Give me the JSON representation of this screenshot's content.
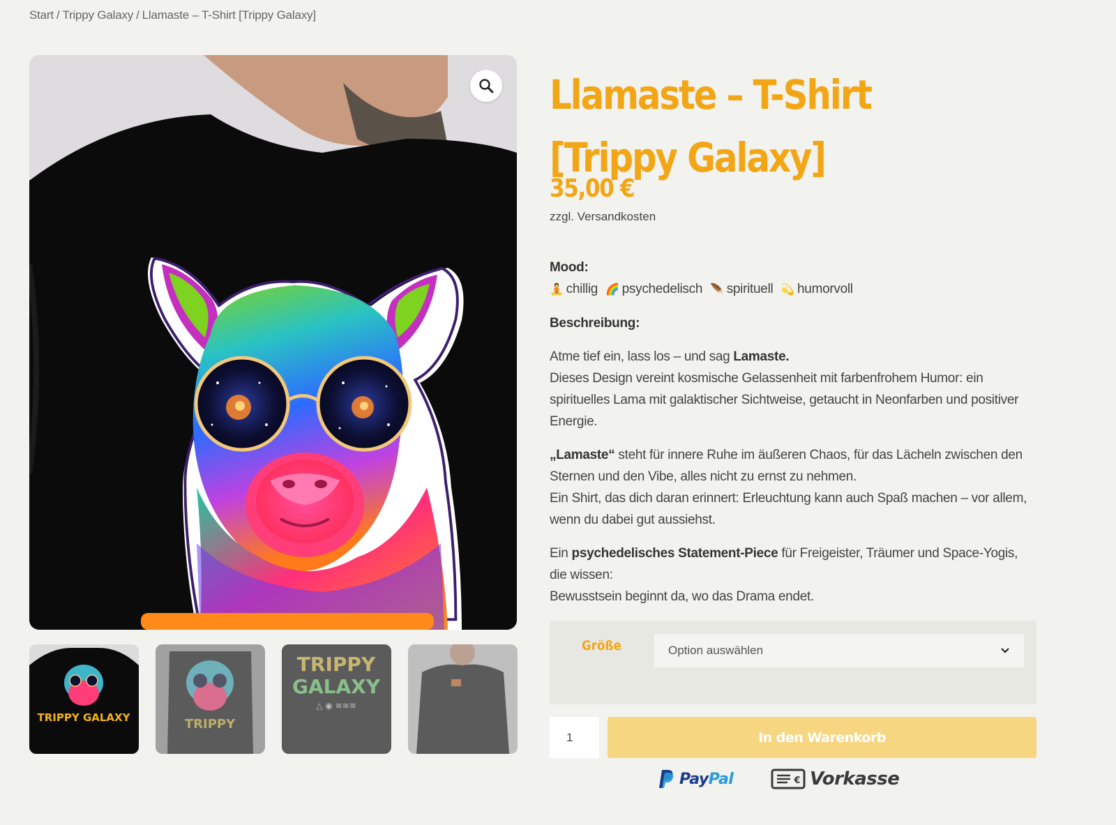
{
  "breadcrumb": {
    "home": "Start",
    "category": "Trippy Galaxy",
    "current": "Llamaste – T-Shirt [Trippy Galaxy]"
  },
  "product": {
    "title": "Llamaste – T-Shirt [Trippy Galaxy]",
    "price": "35,00 €",
    "shipping_note": "zzgl. Versandkosten",
    "image_alt": "Llama with galaxy sunglasses on black t-shirt",
    "badge_text": "TRIPPY GALAXY"
  },
  "description": {
    "mood_heading": "Mood:",
    "moods": [
      {
        "emoji": "🧘",
        "label": "chillig"
      },
      {
        "emoji": "🌈",
        "label": "psychedelisch"
      },
      {
        "emoji": "🪶",
        "label": "spirituell"
      },
      {
        "emoji": "💫",
        "label": "humorvoll"
      }
    ],
    "beschreibung_heading": "Beschreibung:",
    "p1_intro": "Atme tief ein, lass los – und sag ",
    "p1_bold": "Lamaste.",
    "p1_rest": "Dieses Design vereint kosmische Gelassenheit mit farbenfrohem Humor: ein spirituelles Lama mit galaktischer Sichtweise, getaucht in Neonfarben und positiver Energie.",
    "p2_bold": "„Lamaste“",
    "p2_rest": " steht für innere Ruhe im äußeren Chaos, für das Lächeln zwischen den Sternen und den Vibe, alles nicht zu ernst zu nehmen.",
    "p2_line2": "Ein Shirt, das dich daran erinnert: Erleuchtung kann auch Spaß machen – vor allem, wenn du dabei gut aussiehst.",
    "p3_intro": "Ein ",
    "p3_bold": "psychedelisches Statement-Piece",
    "p3_rest": " für Freigeister, Träumer und Space-Yogis, die wissen:",
    "p3_line2": "Bewusstsein beginnt da, wo das Drama endet."
  },
  "variation": {
    "label": "Größe",
    "select_placeholder": "Option auswählen"
  },
  "cart": {
    "quantity": "1",
    "button_label": "In den Warenkorb"
  },
  "payments": {
    "paypal_a": "Pay",
    "paypal_b": "Pal",
    "vorkasse": "Vorkasse"
  },
  "colors": {
    "accent": "#f2a616",
    "cart_button": "#f6d680",
    "background": "#f2f2ee"
  }
}
